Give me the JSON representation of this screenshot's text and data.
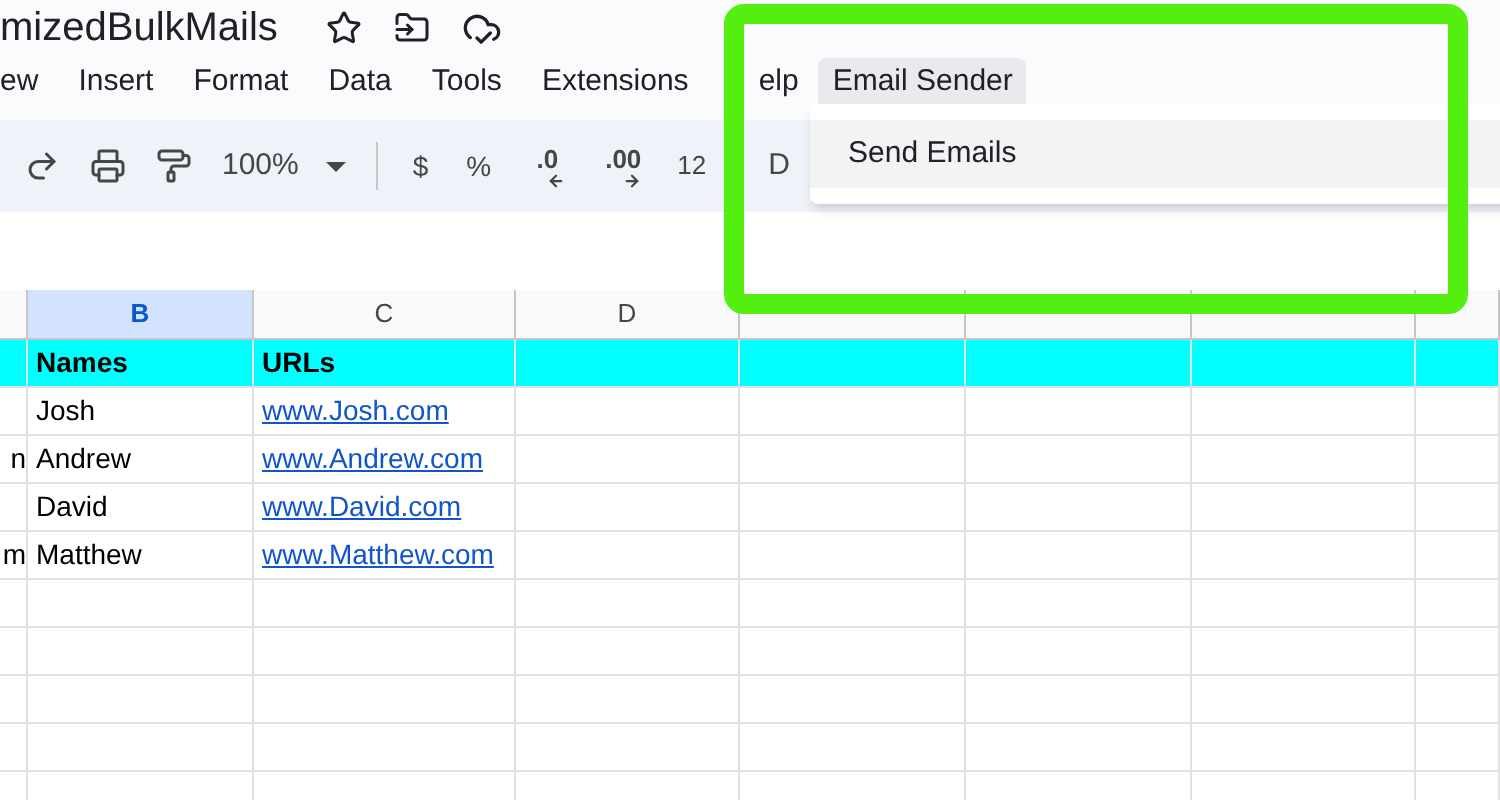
{
  "document": {
    "title": "mizedBulkMails"
  },
  "menu": [
    {
      "label": "ew",
      "selected": false
    },
    {
      "label": "Insert",
      "selected": false
    },
    {
      "label": "Format",
      "selected": false
    },
    {
      "label": "Data",
      "selected": false
    },
    {
      "label": "Tools",
      "selected": false
    },
    {
      "label": "Extensions",
      "selected": false
    },
    {
      "label": "elp",
      "selected": false
    },
    {
      "label": "Email Sender",
      "selected": true
    }
  ],
  "toolbar": {
    "zoom": "100%",
    "currency": "$",
    "percent": "%",
    "decrease_decimals": ".0",
    "increase_decimals": ".00",
    "number_format": "12",
    "font": "D"
  },
  "dropdown": {
    "items": [
      {
        "label": "Send Emails",
        "selected": true
      }
    ]
  },
  "sheet": {
    "columns": [
      {
        "letter": "B",
        "selected": true
      },
      {
        "letter": "C",
        "selected": false
      },
      {
        "letter": "D",
        "selected": false
      }
    ],
    "rows": [
      {
        "kind": "header",
        "col_b": "Names",
        "col_c": "URLs"
      },
      {
        "kind": "data",
        "col_b": "Josh",
        "col_c": "www.Josh.com"
      },
      {
        "kind": "data",
        "col_a": "n",
        "col_b": "Andrew",
        "col_c": "www.Andrew.com"
      },
      {
        "kind": "data",
        "col_b": "David",
        "col_c": "www.David.com"
      },
      {
        "kind": "data",
        "col_a": "m",
        "col_b": "Matthew",
        "col_c": "www.Matthew.com"
      }
    ]
  }
}
